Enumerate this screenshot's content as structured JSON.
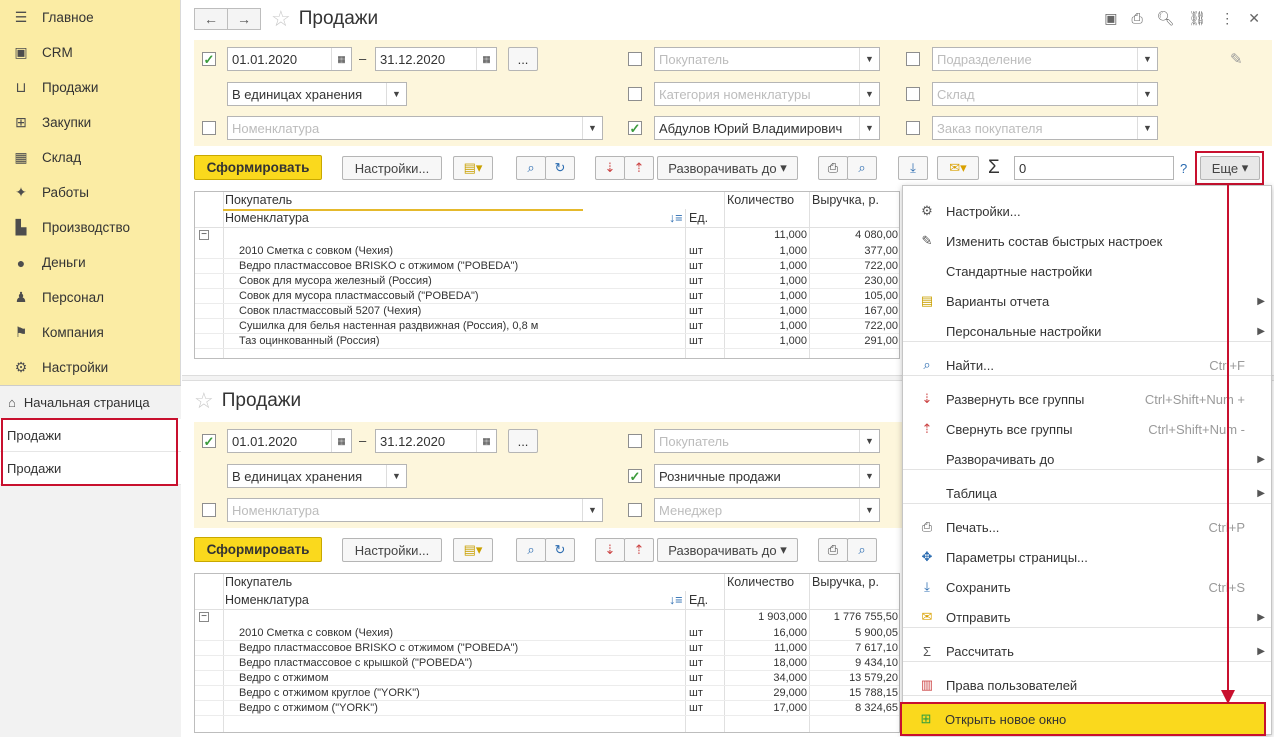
{
  "sidebar": {
    "items": [
      {
        "label": "Главное",
        "icon": "menu-icon"
      },
      {
        "label": "CRM",
        "icon": "crm-icon"
      },
      {
        "label": "Продажи",
        "icon": "basket-icon"
      },
      {
        "label": "Закупки",
        "icon": "cart-icon"
      },
      {
        "label": "Склад",
        "icon": "warehouse-icon"
      },
      {
        "label": "Работы",
        "icon": "tools-icon"
      },
      {
        "label": "Производство",
        "icon": "factory-icon"
      },
      {
        "label": "Деньги",
        "icon": "money-icon"
      },
      {
        "label": "Персонал",
        "icon": "people-icon"
      },
      {
        "label": "Компания",
        "icon": "flag-icon"
      },
      {
        "label": "Настройки",
        "icon": "gear-icon"
      }
    ],
    "home": "Начальная страница",
    "open_windows": [
      "Продажи",
      "Продажи"
    ]
  },
  "top": {
    "title": "Продажи",
    "date_from": "01.01.2020",
    "date_to": "31.12.2020",
    "dots": "...",
    "units": "В единицах хранения",
    "nomen_ph": "Номенклатура",
    "buyer_ph": "Покупатель",
    "category_ph": "Категория номенклатуры",
    "manager": "Абдулов Юрий Владимирович",
    "division_ph": "Подразделение",
    "warehouse_ph": "Склад",
    "order_ph": "Заказ покупателя",
    "generate": "Сформировать",
    "settings": "Настройки...",
    "expand": "Разворачивать до",
    "sum_value": "0",
    "help": "?",
    "more": "Еще",
    "hdr_buyer": "Покупатель",
    "hdr_nomen": "Номенклатура",
    "hdr_unit": "Ед.",
    "hdr_qty": "Количество",
    "hdr_rev": "Выручка, р.",
    "total_qty": "11,000",
    "total_rev": "4 080,00",
    "rows": [
      {
        "name": "2010 Сметка с совком (Чехия)",
        "unit": "шт",
        "qty": "1,000",
        "rev": "377,00"
      },
      {
        "name": "Ведро пластмассовое BRISKO с отжимом (\"POBEDA\")",
        "unit": "шт",
        "qty": "1,000",
        "rev": "722,00"
      },
      {
        "name": "Совок для мусора железный (Россия)",
        "unit": "шт",
        "qty": "1,000",
        "rev": "230,00"
      },
      {
        "name": "Совок для мусора пластмассовый (\"POBEDA\")",
        "unit": "шт",
        "qty": "1,000",
        "rev": "105,00"
      },
      {
        "name": "Совок пластмассовый 5207 (Чехия)",
        "unit": "шт",
        "qty": "1,000",
        "rev": "167,00"
      },
      {
        "name": "Сушилка для белья настенная раздвижная (Россия), 0,8 м",
        "unit": "шт",
        "qty": "1,000",
        "rev": "722,00"
      },
      {
        "name": "Таз оцинкованный (Россия)",
        "unit": "шт",
        "qty": "1,000",
        "rev": "291,00"
      }
    ]
  },
  "bottom": {
    "title": "Продажи",
    "date_from": "01.01.2020",
    "date_to": "31.12.2020",
    "dots": "...",
    "units": "В единицах хранения",
    "nomen_ph": "Номенклатура",
    "buyer_ph": "Покупатель",
    "retail": "Розничные продажи",
    "manager_ph": "Менеджер",
    "generate": "Сформировать",
    "settings": "Настройки...",
    "expand": "Разворачивать до",
    "hdr_buyer": "Покупатель",
    "hdr_nomen": "Номенклатура",
    "hdr_unit": "Ед.",
    "hdr_qty": "Количество",
    "hdr_rev": "Выручка, р.",
    "total_qty": "1 903,000",
    "total_rev": "1 776 755,50",
    "rows": [
      {
        "name": "2010 Сметка с совком (Чехия)",
        "unit": "шт",
        "qty": "16,000",
        "rev": "5 900,05"
      },
      {
        "name": "Ведро пластмассовое BRISKO с отжимом (\"POBEDA\")",
        "unit": "шт",
        "qty": "11,000",
        "rev": "7 617,10"
      },
      {
        "name": "Ведро пластмассовое с крышкой (\"POBEDA\")",
        "unit": "шт",
        "qty": "18,000",
        "rev": "9 434,10"
      },
      {
        "name": "Ведро с отжимом",
        "unit": "шт",
        "qty": "34,000",
        "rev": "13 579,20"
      },
      {
        "name": "Ведро с отжимом  круглое (\"YORK\")",
        "unit": "шт",
        "qty": "29,000",
        "rev": "15 788,15"
      },
      {
        "name": "Ведро с отжимом (\"YORK\")",
        "unit": "шт",
        "qty": "17,000",
        "rev": "8 324,65"
      }
    ]
  },
  "menu": {
    "items": [
      {
        "label": "Настройки...",
        "icon": "settings-icon",
        "shortcut": "",
        "arrow": false
      },
      {
        "label": "Изменить состав быстрых настроек",
        "icon": "pin-icon",
        "shortcut": "",
        "arrow": false
      },
      {
        "label": "Стандартные настройки",
        "icon": "",
        "shortcut": "",
        "arrow": false
      },
      {
        "label": "Варианты отчета",
        "icon": "variants-icon",
        "shortcut": "",
        "arrow": true
      },
      {
        "label": "Персональные настройки",
        "icon": "",
        "shortcut": "",
        "arrow": true
      },
      {
        "label": "Найти...",
        "icon": "search-icon",
        "shortcut": "Ctrl+F",
        "arrow": false
      },
      {
        "label": "Развернуть все группы",
        "icon": "expand-icon",
        "shortcut": "Ctrl+Shift+Num +",
        "arrow": false
      },
      {
        "label": "Свернуть все группы",
        "icon": "collapse-icon",
        "shortcut": "Ctrl+Shift+Num -",
        "arrow": false
      },
      {
        "label": "Разворачивать до",
        "icon": "",
        "shortcut": "",
        "arrow": true
      },
      {
        "label": "Таблица",
        "icon": "",
        "shortcut": "",
        "arrow": true
      },
      {
        "label": "Печать...",
        "icon": "print-icon",
        "shortcut": "Ctrl+P",
        "arrow": false
      },
      {
        "label": "Параметры страницы...",
        "icon": "page-settings-icon",
        "shortcut": "",
        "arrow": false
      },
      {
        "label": "Сохранить",
        "icon": "save-icon",
        "shortcut": "Ctrl+S",
        "arrow": false
      },
      {
        "label": "Отправить",
        "icon": "mail-icon",
        "shortcut": "",
        "arrow": true
      },
      {
        "label": "Рассчитать",
        "icon": "sigma-icon",
        "shortcut": "",
        "arrow": true
      },
      {
        "label": "Права пользователей",
        "icon": "rights-icon",
        "shortcut": "",
        "arrow": false
      },
      {
        "label": "Открыть новое окно",
        "icon": "new-window-icon",
        "shortcut": "",
        "arrow": false
      }
    ]
  },
  "colors": {
    "accent": "#fad91d",
    "sidebar": "#fbeca4",
    "highlight": "#c8102e"
  }
}
